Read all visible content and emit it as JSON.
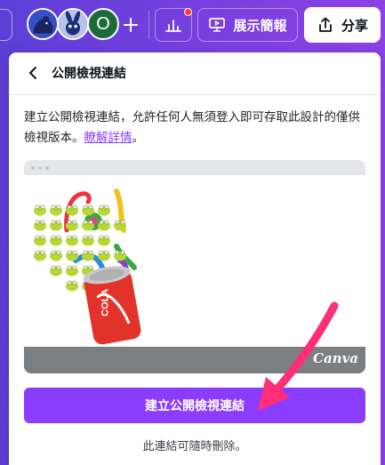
{
  "topbar": {
    "avatars": [
      {
        "name": "avatar-bear",
        "color": "#2a3f9e"
      },
      {
        "name": "avatar-rabbit",
        "color": "#1c2f7a"
      },
      {
        "name": "avatar-o",
        "letter": "O"
      }
    ],
    "present_label": "展示簡報",
    "share_label": "分享"
  },
  "panel": {
    "title": "公開檢視連結",
    "description": "建立公開檢視連結，允許任何人無須登入即可存取此設計的僅供檢視版本。",
    "learn_more": "瞭解詳情",
    "period": "。",
    "preview_logo": "Canva",
    "create_button": "建立公開檢視連結",
    "note": "此連結可隨時刪除。"
  },
  "colors": {
    "accent": "#8b3dff",
    "annotation_arrow": "#ff2e78",
    "header_gradient_start": "#5b3fd6",
    "header_gradient_end": "#8c41e6"
  }
}
